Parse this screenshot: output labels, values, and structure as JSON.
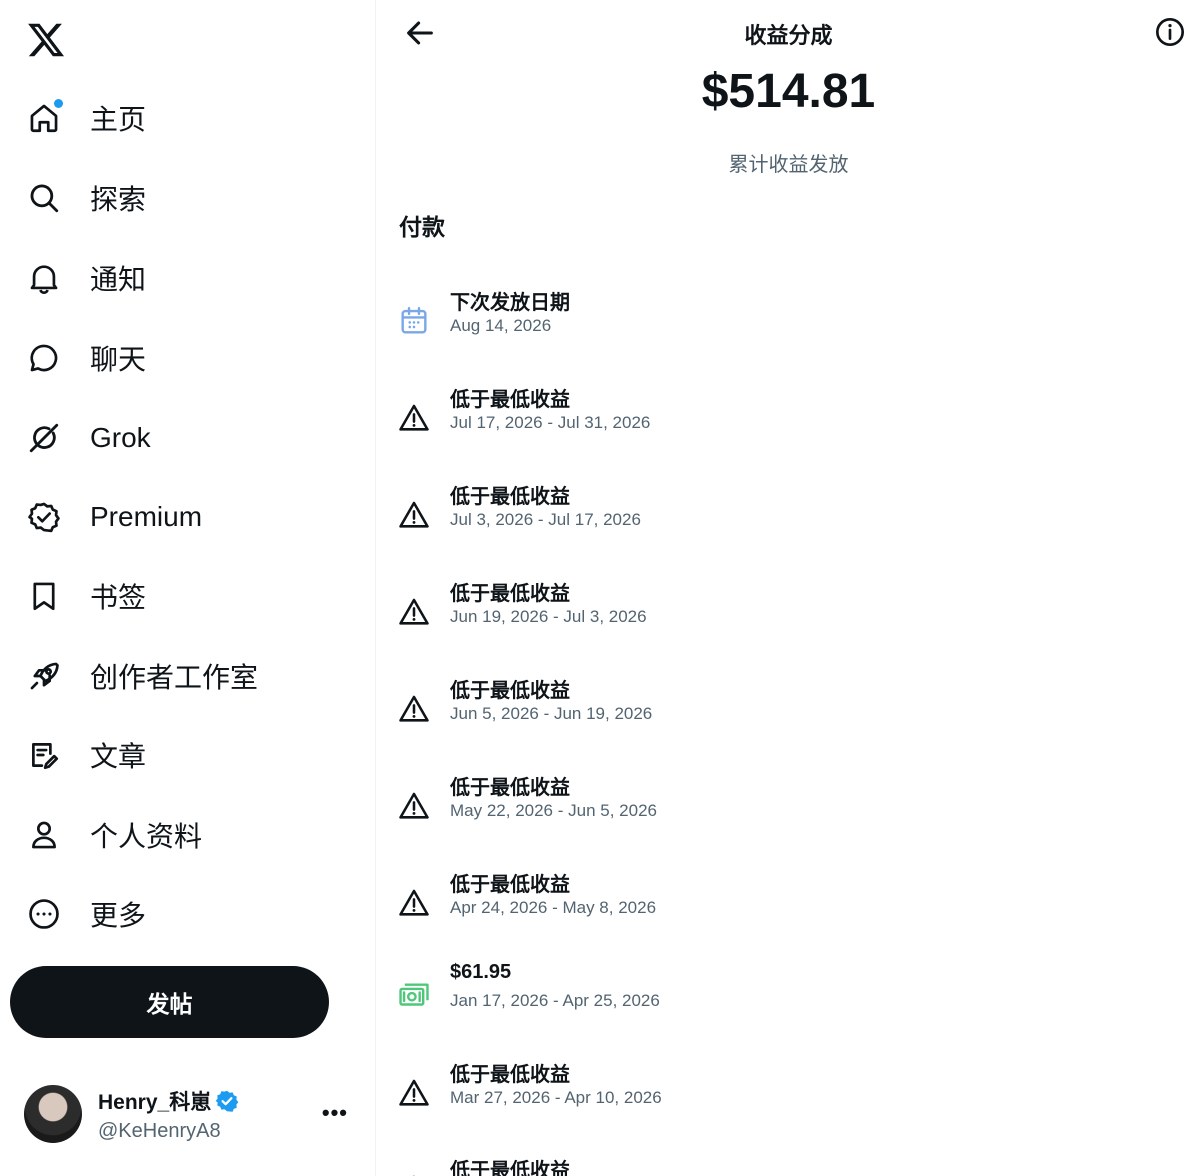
{
  "sidebar": {
    "nav": [
      {
        "label": "主页",
        "icon": "home-icon"
      },
      {
        "label": "探索",
        "icon": "search-icon"
      },
      {
        "label": "通知",
        "icon": "bell-icon"
      },
      {
        "label": "聊天",
        "icon": "chat-bubble-icon"
      },
      {
        "label": "Grok",
        "icon": "grok-icon"
      },
      {
        "label": "Premium",
        "icon": "premium-badge-icon"
      },
      {
        "label": "书签",
        "icon": "bookmark-icon"
      },
      {
        "label": "创作者工作室",
        "icon": "rocket-icon"
      },
      {
        "label": "文章",
        "icon": "article-icon"
      },
      {
        "label": "个人资料",
        "icon": "person-icon"
      },
      {
        "label": "更多",
        "icon": "more-circle-icon"
      }
    ],
    "post_label": "发帖",
    "profile": {
      "name": "Henry_科崽",
      "handle": "@KeHenryA8"
    }
  },
  "main": {
    "title": "收益分成",
    "amount": "$514.81",
    "amount_label": "累计收益发放",
    "section_title": "付款",
    "payments": [
      {
        "title": "下次发放日期",
        "sub": "Aug 14, 2026",
        "icon": "calendar-icon"
      },
      {
        "title": "低于最低收益",
        "sub": "Jul 17, 2026 - Jul 31, 2026",
        "icon": "warning-icon"
      },
      {
        "title": "低于最低收益",
        "sub": "Jul 3, 2026 - Jul 17, 2026",
        "icon": "warning-icon"
      },
      {
        "title": "低于最低收益",
        "sub": "Jun 19, 2026 - Jul 3, 2026",
        "icon": "warning-icon"
      },
      {
        "title": "低于最低收益",
        "sub": "Jun 5, 2026 - Jun 19, 2026",
        "icon": "warning-icon"
      },
      {
        "title": "低于最低收益",
        "sub": "May 22, 2026 - Jun 5, 2026",
        "icon": "warning-icon"
      },
      {
        "title": "低于最低收益",
        "sub": "Apr 24, 2026 - May 8, 2026",
        "icon": "warning-icon"
      },
      {
        "title": "$61.95",
        "sub": "Jan 17, 2026 - Apr 25, 2026",
        "icon": "money-icon"
      },
      {
        "title": "低于最低收益",
        "sub": "Mar 27, 2026 - Apr 10, 2026",
        "icon": "warning-icon"
      },
      {
        "title": "低于最低收益",
        "sub": "",
        "icon": "warning-icon"
      }
    ]
  },
  "colors": {
    "text": "#0f1419",
    "secondary": "#536471",
    "accent": "#1d9bf0",
    "calendar": "#7aa7e8",
    "money": "#4fc77a"
  }
}
